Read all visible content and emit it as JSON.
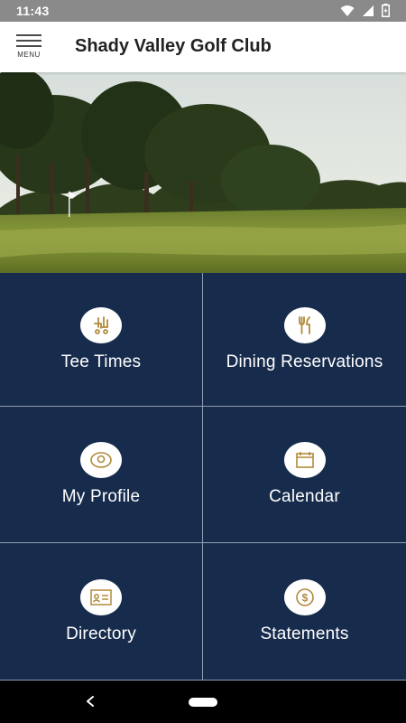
{
  "status_bar": {
    "time": "11:43"
  },
  "app_bar": {
    "menu_label": "MENU",
    "title": "Shady Valley Golf Club"
  },
  "tiles": [
    {
      "label": "Tee Times",
      "icon": "golf-cart-icon"
    },
    {
      "label": "Dining Reservations",
      "icon": "fork-knife-icon"
    },
    {
      "label": "My Profile",
      "icon": "profile-icon"
    },
    {
      "label": "Calendar",
      "icon": "calendar-icon"
    },
    {
      "label": "Directory",
      "icon": "directory-card-icon"
    },
    {
      "label": "Statements",
      "icon": "dollar-coin-icon"
    }
  ],
  "colors": {
    "tile_bg": "#172c4c",
    "icon_gold": "#b08a3c",
    "status_bar": "#8a8a8a"
  }
}
